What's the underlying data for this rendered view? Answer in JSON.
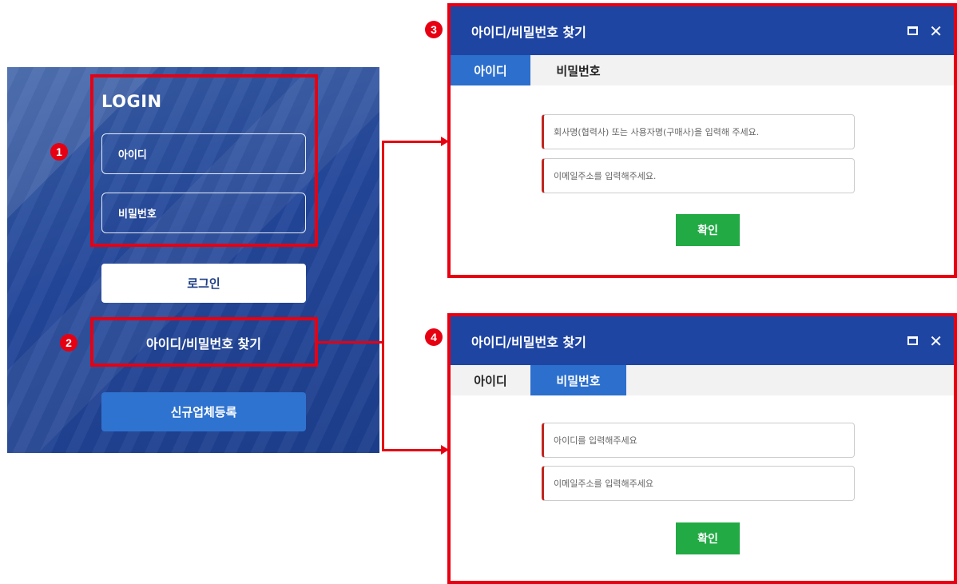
{
  "login": {
    "title": "LOGIN",
    "id_field": "아이디",
    "password_field": "비밀번호",
    "login_button": "로그인",
    "find_link": "아이디/비밀번호 찾기",
    "register_button": "신규업체등록"
  },
  "badges": [
    "1",
    "2",
    "3",
    "4"
  ],
  "dialog_find_id": {
    "title": "아이디/비밀번호 찾기",
    "tabs": [
      {
        "label": "아이디",
        "active": true
      },
      {
        "label": "비밀번호",
        "active": false
      }
    ],
    "fields": [
      {
        "placeholder": "회사명(협력사) 또는 사용자명(구매사)을 입력해 주세요."
      },
      {
        "placeholder": "이메일주소를 입력해주세요."
      }
    ],
    "confirm": "확인"
  },
  "dialog_find_password": {
    "title": "아이디/비밀번호 찾기",
    "tabs": [
      {
        "label": "아이디",
        "active": false
      },
      {
        "label": "비밀번호",
        "active": true
      }
    ],
    "fields": [
      {
        "placeholder": "아이디를 입력해주세요"
      },
      {
        "placeholder": "이메일주소를 입력해주세요"
      }
    ],
    "confirm": "확인"
  },
  "icons": {
    "maximize": "maximize-icon",
    "close": "close-icon"
  },
  "colors": {
    "annotation_red": "#e60012",
    "header_blue": "#1f45a3",
    "active_tab_blue": "#2c6fcd",
    "confirm_green": "#22aa44",
    "register_blue": "#2f73d0"
  }
}
